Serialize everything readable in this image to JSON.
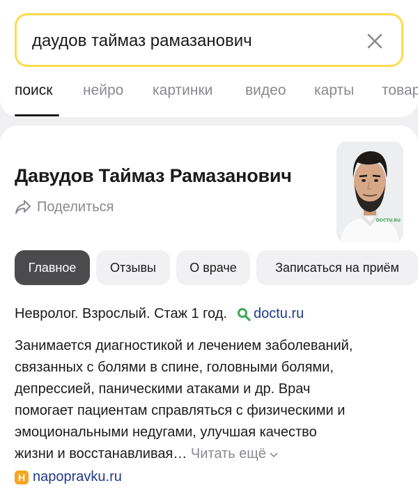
{
  "search": {
    "value": "даудов таймаз рамазанович"
  },
  "tabs": [
    {
      "label": "поиск",
      "active": true
    },
    {
      "label": "нейро"
    },
    {
      "label": "картинки"
    },
    {
      "label": "видео"
    },
    {
      "label": "карты"
    },
    {
      "label": "товары"
    }
  ],
  "card": {
    "name": "Давудов Таймаз Рамазанович",
    "share_label": "Поделиться",
    "photo_watermark": "DOCTU.RU",
    "chips": [
      {
        "label": "Главное",
        "active": true
      },
      {
        "label": "Отзывы"
      },
      {
        "label": "О враче"
      },
      {
        "label": "Записаться на приём"
      }
    ],
    "specialty": "Невролог. Взрослый. Стаж 1 год.",
    "source_link": "doctu.ru",
    "description_lines": [
      "Занимается диагностикой и лечением заболеваний,",
      "связанных с болями в спине, головными болями,",
      "депрессией, паническими атаками и др. Врач",
      "помогает пациентам справляться с физическими и",
      "эмоциональными недугами, улучшая качество",
      "жизни и восстанавливая…"
    ],
    "read_more": "Читать ещё",
    "second_source": {
      "badge": "Н",
      "label": "napopravku.ru"
    }
  },
  "colors": {
    "search_border": "#fedb4d",
    "active_chip": "#4b4b4d",
    "link": "#1f3a8a",
    "badge": "#f5a623",
    "source_icon": "#3aa757"
  }
}
